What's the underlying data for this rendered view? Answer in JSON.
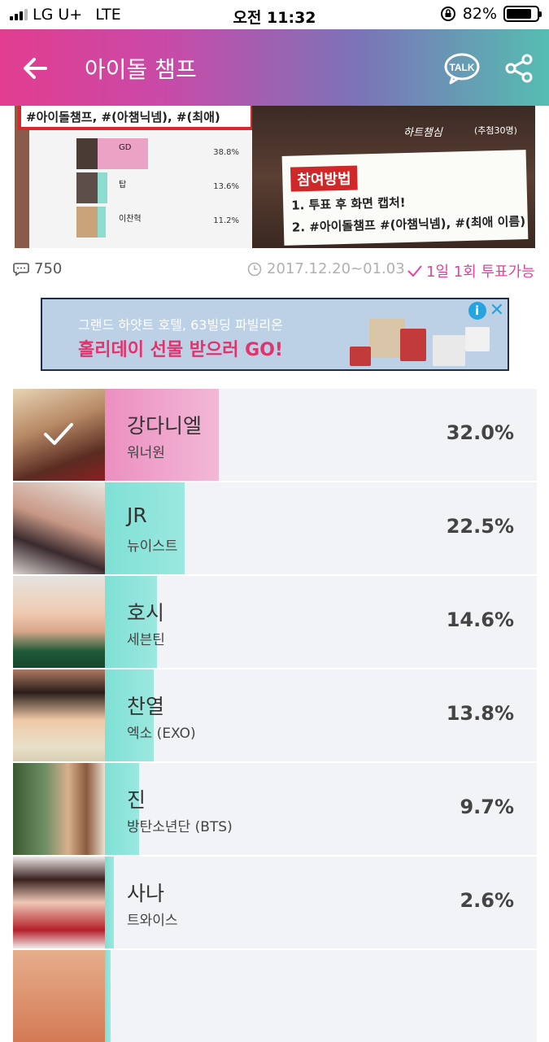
{
  "status": {
    "carrier": "LG U+",
    "network": "LTE",
    "time": "오전 11:32",
    "battery": "82%",
    "battery_level": 0.82
  },
  "header": {
    "title": "아이돌 챔프",
    "talk_label": "TALK"
  },
  "banner": {
    "hashtag": "#아이돌챔프, #(아챔닉넴), #(최애)",
    "mini_list": [
      {
        "name": "GD",
        "percent": "38.8%"
      },
      {
        "name": "탑",
        "percent": "13.6%"
      },
      {
        "name": "이찬혁",
        "percent": "11.2%"
      }
    ],
    "brand": "하트챔심",
    "prize_note": "(추첨30명)",
    "participate_title": "참여방법",
    "steps": [
      "1. 투표 후 화면 캡처!",
      "2. #아이돌챔프 #(아챔닉넴), #(최애 이름)"
    ]
  },
  "meta": {
    "comment_count": "750",
    "period": "2017.12.20~01.03",
    "vote_rule": "1일 1회 투표가능"
  },
  "ad": {
    "line1": "그랜드 하얏트 호텔, 63빌딩 파빌리온",
    "line2": "홀리데이 선물 받으러 GO!"
  },
  "colors": {
    "accent_pink": "#e0449a",
    "leader_bar": "#ec8fc0",
    "bar": "#7fe0d5"
  },
  "ranking": [
    {
      "name": "강다니엘",
      "group": "워너원",
      "percent": "32.0%",
      "value": 32.0,
      "selected": true
    },
    {
      "name": "JR",
      "group": "뉴이스트",
      "percent": "22.5%",
      "value": 22.5
    },
    {
      "name": "호시",
      "group": "세븐틴",
      "percent": "14.6%",
      "value": 14.6
    },
    {
      "name": "찬열",
      "group": "엑소 (EXO)",
      "percent": "13.8%",
      "value": 13.8
    },
    {
      "name": "진",
      "group": "방탄소년단 (BTS)",
      "percent": "9.7%",
      "value": 9.7
    },
    {
      "name": "사나",
      "group": "트와이스",
      "percent": "2.6%",
      "value": 2.6
    },
    {
      "name": "",
      "group": "",
      "percent": "",
      "value": 1.5
    }
  ]
}
